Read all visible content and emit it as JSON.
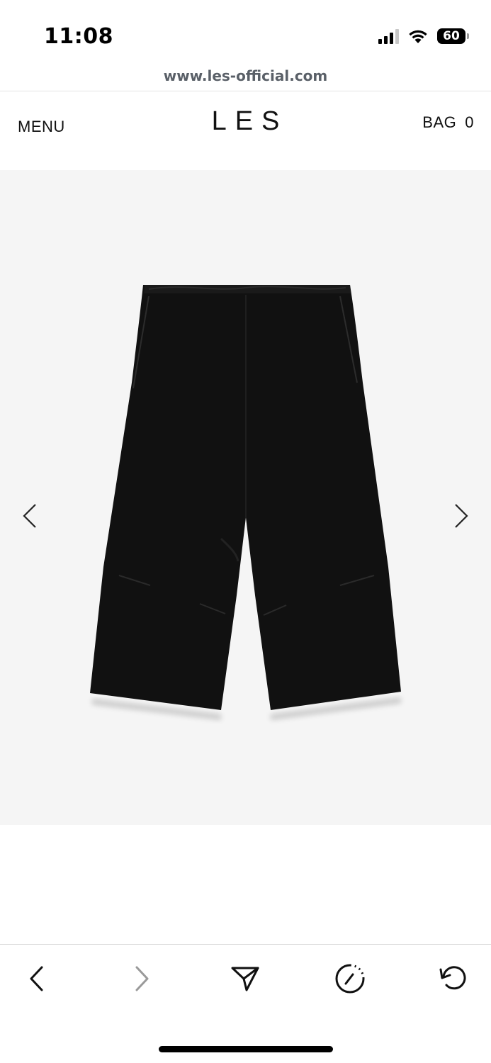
{
  "status_bar": {
    "time": "11:08",
    "battery_level": "60",
    "icons": [
      "signal-icon",
      "wifi-icon",
      "battery-icon"
    ]
  },
  "browser": {
    "url": "www.les-official.com"
  },
  "header": {
    "menu_label": "MENU",
    "logo": "LES",
    "bag_label": "BAG",
    "bag_count": "0"
  },
  "gallery": {
    "background_color": "#f5f5f5",
    "product_color": "#111111",
    "prev_icon": "chevron-left-icon",
    "next_icon": "chevron-right-icon"
  },
  "toolbar": {
    "items": [
      {
        "name": "back-button",
        "icon": "chevron-left-icon"
      },
      {
        "name": "forward-button",
        "icon": "chevron-right-icon",
        "disabled": true
      },
      {
        "name": "share-button",
        "icon": "send-icon"
      },
      {
        "name": "speed-dial-button",
        "icon": "gauge-icon"
      },
      {
        "name": "reload-button",
        "icon": "reload-icon"
      }
    ]
  }
}
